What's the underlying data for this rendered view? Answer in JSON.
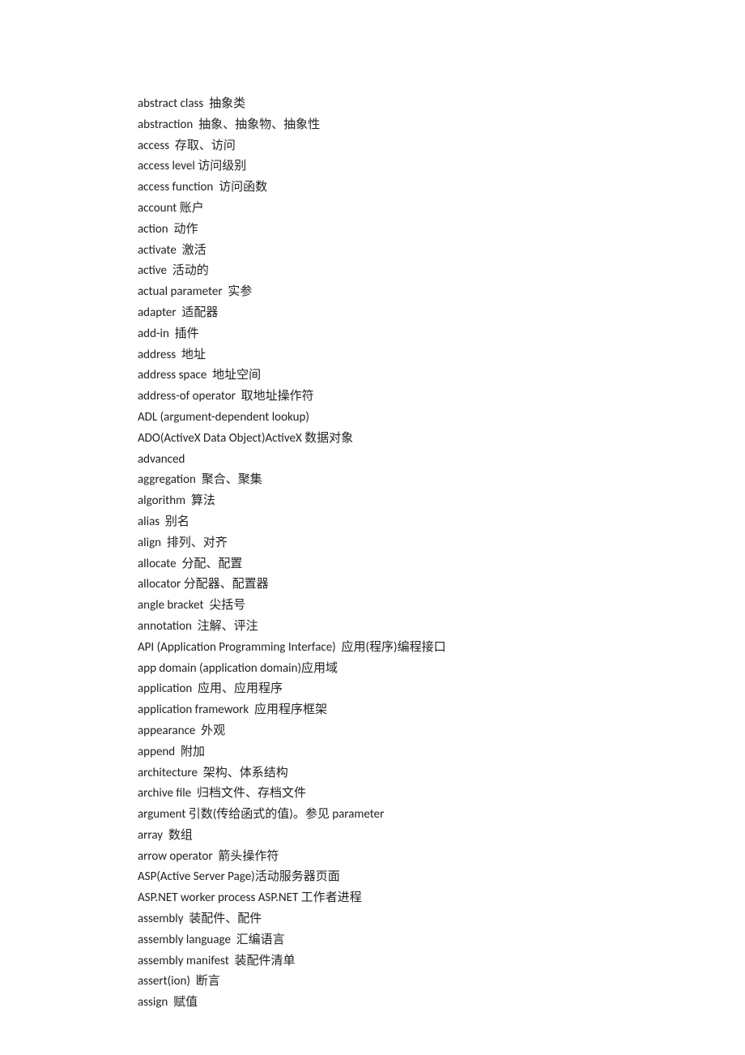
{
  "entries": [
    "abstract class  抽象类",
    "abstraction  抽象、抽象物、抽象性",
    "access  存取、访问",
    "access level 访问级别",
    "access function  访问函数",
    "account 账户",
    "action  动作",
    "activate  激活",
    "active  活动的",
    "actual parameter  实参",
    "adapter  适配器",
    "add-in  插件",
    "address  地址",
    "address space  地址空间",
    "address-of operator  取地址操作符",
    "ADL (argument-dependent lookup)",
    "ADO(ActiveX Data Object)ActiveX 数据对象",
    "advanced",
    "aggregation  聚合、聚集",
    "algorithm  算法",
    "alias  别名",
    "align  排列、对齐",
    "allocate  分配、配置",
    "allocator 分配器、配置器",
    "angle bracket  尖括号",
    "annotation  注解、评注",
    "API (Application Programming Interface)  应用(程序)编程接口",
    "app domain (application domain)应用域",
    "application  应用、应用程序",
    "application framework  应用程序框架",
    "appearance  外观",
    "append  附加",
    "architecture  架构、体系结构",
    "archive file  归档文件、存档文件",
    "argument 引数(传给函式的值)。参见 parameter",
    "array  数组",
    "arrow operator  箭头操作符",
    "ASP(Active Server Page)活动服务器页面",
    "ASP.NET worker process ASP.NET 工作者进程",
    "assembly  装配件、配件",
    "assembly language  汇编语言",
    "assembly manifest  装配件清单",
    "assert(ion)  断言",
    "assign  赋值"
  ]
}
